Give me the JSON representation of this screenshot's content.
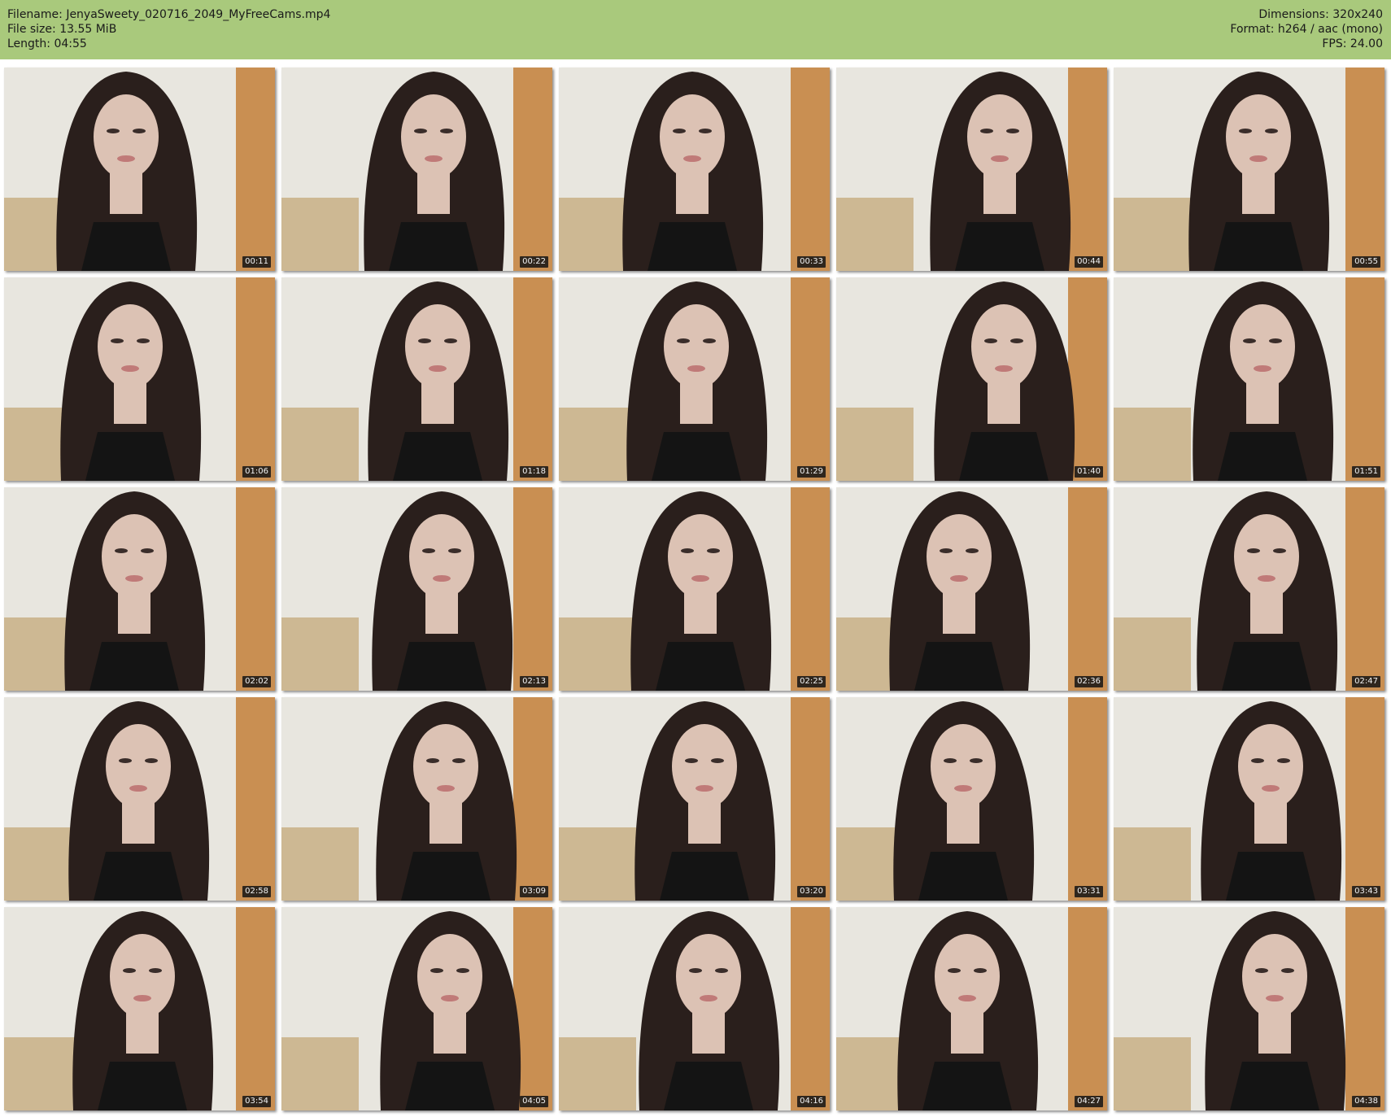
{
  "header": {
    "filename_label": "Filename:",
    "filename": "JenyaSweety_020716_2049_MyFreeCams.mp4",
    "filesize_label": "File size:",
    "filesize": "13.55 MiB",
    "length_label": "Length:",
    "length": "04:55",
    "dimensions_label": "Dimensions:",
    "dimensions": "320x240",
    "format_label": "Format:",
    "format": "h264 / aac (mono)",
    "fps_label": "FPS:",
    "fps": "24.00"
  },
  "thumbnails": [
    {
      "time": "00:11"
    },
    {
      "time": "00:22"
    },
    {
      "time": "00:33"
    },
    {
      "time": "00:44"
    },
    {
      "time": "00:55"
    },
    {
      "time": "01:06"
    },
    {
      "time": "01:18"
    },
    {
      "time": "01:29"
    },
    {
      "time": "01:40"
    },
    {
      "time": "01:51"
    },
    {
      "time": "02:02"
    },
    {
      "time": "02:13"
    },
    {
      "time": "02:25"
    },
    {
      "time": "02:36"
    },
    {
      "time": "02:47"
    },
    {
      "time": "02:58"
    },
    {
      "time": "03:09"
    },
    {
      "time": "03:20"
    },
    {
      "time": "03:31"
    },
    {
      "time": "03:43"
    },
    {
      "time": "03:54"
    },
    {
      "time": "04:05"
    },
    {
      "time": "04:16"
    },
    {
      "time": "04:27"
    },
    {
      "time": "04:38"
    }
  ],
  "colors": {
    "header_bg": "#a9c97c",
    "wall": "#e8e6df",
    "door": "#c98f52",
    "hair": "#2a1f1c",
    "skin": "#dcc2b4",
    "pillow": "#cdb893",
    "top": "#141414"
  }
}
